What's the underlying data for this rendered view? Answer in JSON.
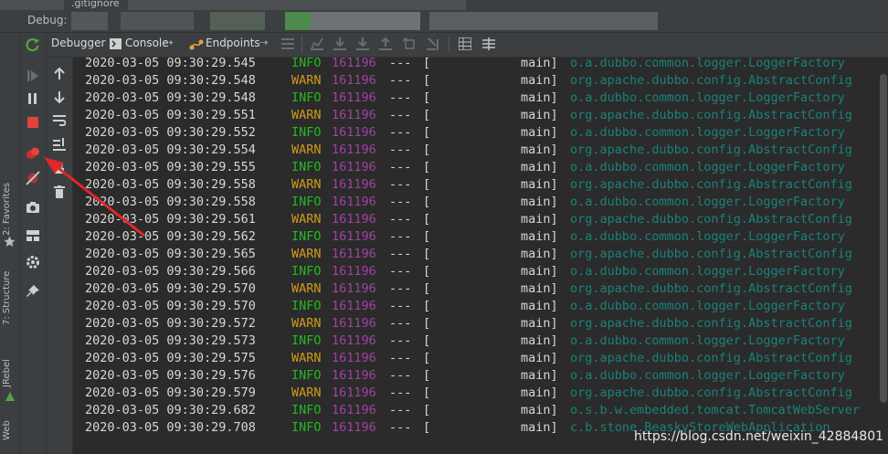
{
  "top_strip": {
    "filename": ".gitignore"
  },
  "window": {
    "title": "Debug:"
  },
  "tabs": [
    {
      "label": "Debugger"
    },
    {
      "label": "Console",
      "pin": "⇢"
    },
    {
      "label": "Endpoints",
      "pin": "⇢"
    }
  ],
  "side_labels": {
    "favorites": "2: Favorites",
    "structure": "7: Structure",
    "jrebel": "JRebel",
    "web": "Web"
  },
  "log_rows": [
    {
      "ts": "2020-03-05 09:30:29.545",
      "level": "INFO",
      "pid": "161196",
      "sep": "---",
      "bracket": "[",
      "thread": "main]",
      "logger": "o.a.dubbo.common.logger.LoggerFactory"
    },
    {
      "ts": "2020-03-05 09:30:29.548",
      "level": "WARN",
      "pid": "161196",
      "sep": "---",
      "bracket": "[",
      "thread": "main]",
      "logger": "org.apache.dubbo.config.AbstractConfig"
    },
    {
      "ts": "2020-03-05 09:30:29.548",
      "level": "INFO",
      "pid": "161196",
      "sep": "---",
      "bracket": "[",
      "thread": "main]",
      "logger": "o.a.dubbo.common.logger.LoggerFactory"
    },
    {
      "ts": "2020-03-05 09:30:29.551",
      "level": "WARN",
      "pid": "161196",
      "sep": "---",
      "bracket": "[",
      "thread": "main]",
      "logger": "org.apache.dubbo.config.AbstractConfig"
    },
    {
      "ts": "2020-03-05 09:30:29.552",
      "level": "INFO",
      "pid": "161196",
      "sep": "---",
      "bracket": "[",
      "thread": "main]",
      "logger": "o.a.dubbo.common.logger.LoggerFactory"
    },
    {
      "ts": "2020-03-05 09:30:29.554",
      "level": "WARN",
      "pid": "161196",
      "sep": "---",
      "bracket": "[",
      "thread": "main]",
      "logger": "org.apache.dubbo.config.AbstractConfig"
    },
    {
      "ts": "2020-03-05 09:30:29.555",
      "level": "INFO",
      "pid": "161196",
      "sep": "---",
      "bracket": "[",
      "thread": "main]",
      "logger": "o.a.dubbo.common.logger.LoggerFactory"
    },
    {
      "ts": "2020-03-05 09:30:29.558",
      "level": "WARN",
      "pid": "161196",
      "sep": "---",
      "bracket": "[",
      "thread": "main]",
      "logger": "org.apache.dubbo.config.AbstractConfig"
    },
    {
      "ts": "2020-03-05 09:30:29.558",
      "level": "INFO",
      "pid": "161196",
      "sep": "---",
      "bracket": "[",
      "thread": "main]",
      "logger": "o.a.dubbo.common.logger.LoggerFactory"
    },
    {
      "ts": "2020-03-05 09:30:29.561",
      "level": "WARN",
      "pid": "161196",
      "sep": "---",
      "bracket": "[",
      "thread": "main]",
      "logger": "org.apache.dubbo.config.AbstractConfig"
    },
    {
      "ts": "2020-03-05 09:30:29.562",
      "level": "INFO",
      "pid": "161196",
      "sep": "---",
      "bracket": "[",
      "thread": "main]",
      "logger": "o.a.dubbo.common.logger.LoggerFactory"
    },
    {
      "ts": "2020-03-05 09:30:29.565",
      "level": "WARN",
      "pid": "161196",
      "sep": "---",
      "bracket": "[",
      "thread": "main]",
      "logger": "org.apache.dubbo.config.AbstractConfig"
    },
    {
      "ts": "2020-03-05 09:30:29.566",
      "level": "INFO",
      "pid": "161196",
      "sep": "---",
      "bracket": "[",
      "thread": "main]",
      "logger": "o.a.dubbo.common.logger.LoggerFactory"
    },
    {
      "ts": "2020-03-05 09:30:29.570",
      "level": "WARN",
      "pid": "161196",
      "sep": "---",
      "bracket": "[",
      "thread": "main]",
      "logger": "org.apache.dubbo.config.AbstractConfig"
    },
    {
      "ts": "2020-03-05 09:30:29.570",
      "level": "INFO",
      "pid": "161196",
      "sep": "---",
      "bracket": "[",
      "thread": "main]",
      "logger": "o.a.dubbo.common.logger.LoggerFactory"
    },
    {
      "ts": "2020-03-05 09:30:29.572",
      "level": "WARN",
      "pid": "161196",
      "sep": "---",
      "bracket": "[",
      "thread": "main]",
      "logger": "org.apache.dubbo.config.AbstractConfig"
    },
    {
      "ts": "2020-03-05 09:30:29.573",
      "level": "INFO",
      "pid": "161196",
      "sep": "---",
      "bracket": "[",
      "thread": "main]",
      "logger": "o.a.dubbo.common.logger.LoggerFactory"
    },
    {
      "ts": "2020-03-05 09:30:29.575",
      "level": "WARN",
      "pid": "161196",
      "sep": "---",
      "bracket": "[",
      "thread": "main]",
      "logger": "org.apache.dubbo.config.AbstractConfig"
    },
    {
      "ts": "2020-03-05 09:30:29.576",
      "level": "INFO",
      "pid": "161196",
      "sep": "---",
      "bracket": "[",
      "thread": "main]",
      "logger": "o.a.dubbo.common.logger.LoggerFactory"
    },
    {
      "ts": "2020-03-05 09:30:29.579",
      "level": "WARN",
      "pid": "161196",
      "sep": "---",
      "bracket": "[",
      "thread": "main]",
      "logger": "org.apache.dubbo.config.AbstractConfig"
    },
    {
      "ts": "2020-03-05 09:30:29.682",
      "level": "INFO",
      "pid": "161196",
      "sep": "---",
      "bracket": "[",
      "thread": "main]",
      "logger": "o.s.b.w.embedded.tomcat.TomcatWebServer"
    },
    {
      "ts": "2020-03-05 09:30:29.708",
      "level": "INFO",
      "pid": "161196",
      "sep": "---",
      "bracket": "[",
      "thread": "main]",
      "logger": "c.b.stone.BeaskyStoreWebApplication"
    }
  ],
  "watermark": "https://blog.csdn.net/weixin_42884801",
  "colors": {
    "info": "#1fba1f",
    "warn": "#d19a1b",
    "pid": "#a142a5",
    "logger": "#1a8279",
    "annotation_arrow": "#e2262a"
  }
}
